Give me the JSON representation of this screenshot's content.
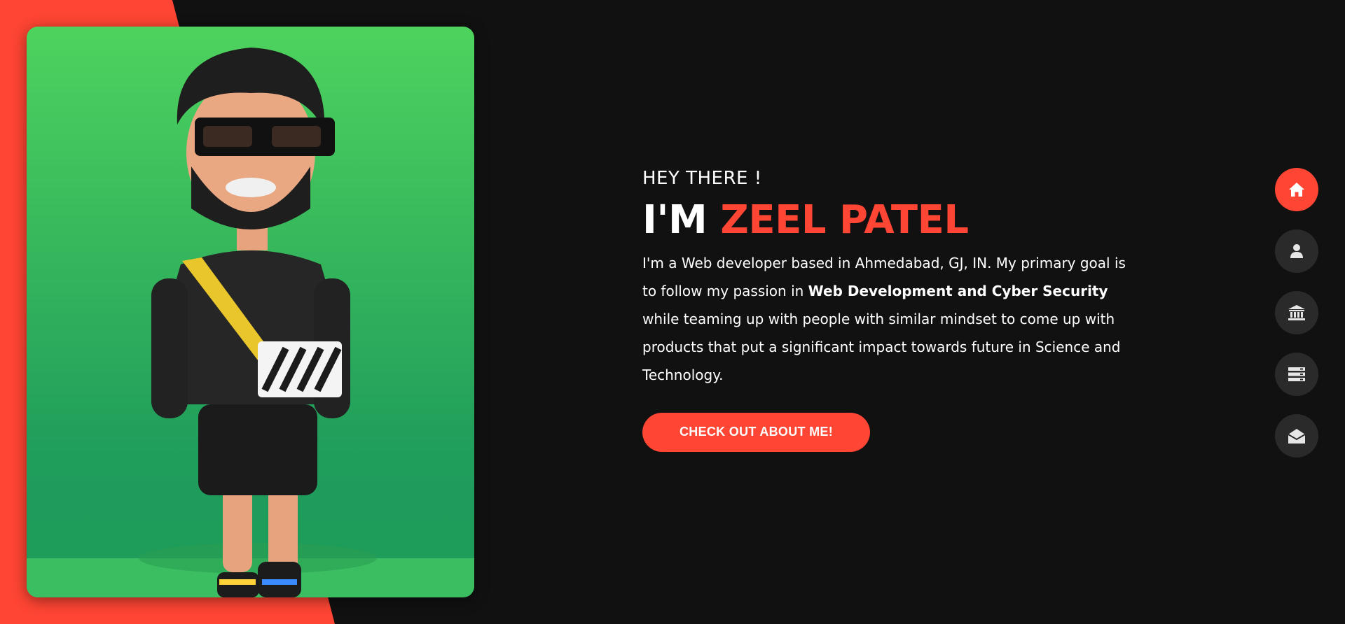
{
  "colors": {
    "accent": "#ff4533",
    "background": "#111111",
    "nav_button": "#2b2a2a",
    "photo_green_top": "#4ed35e",
    "photo_green_bottom": "#1e9b5a"
  },
  "hero": {
    "greeting": "HEY THERE !",
    "headline_prefix": "I'M",
    "headline_name": "ZEEL PATEL",
    "bio_part1": "I'm a Web developer based in Ahmedabad, GJ, IN. My primary goal is to follow my passion in",
    "bio_bold": "Web Development and Cyber Security",
    "bio_part2": "while teaming up with people with similar mindset to come up with products that put a significant impact towards future in Science and Technology.",
    "cta_label": "CHECK OUT ABOUT ME!"
  },
  "side_nav": {
    "items": [
      {
        "icon": "home-icon",
        "active": true
      },
      {
        "icon": "user-icon",
        "active": false
      },
      {
        "icon": "bank-icon",
        "active": false
      },
      {
        "icon": "server-icon",
        "active": false
      },
      {
        "icon": "envelope-open-icon",
        "active": false
      }
    ]
  },
  "photo": {
    "depiction": "avatar-illustration"
  }
}
